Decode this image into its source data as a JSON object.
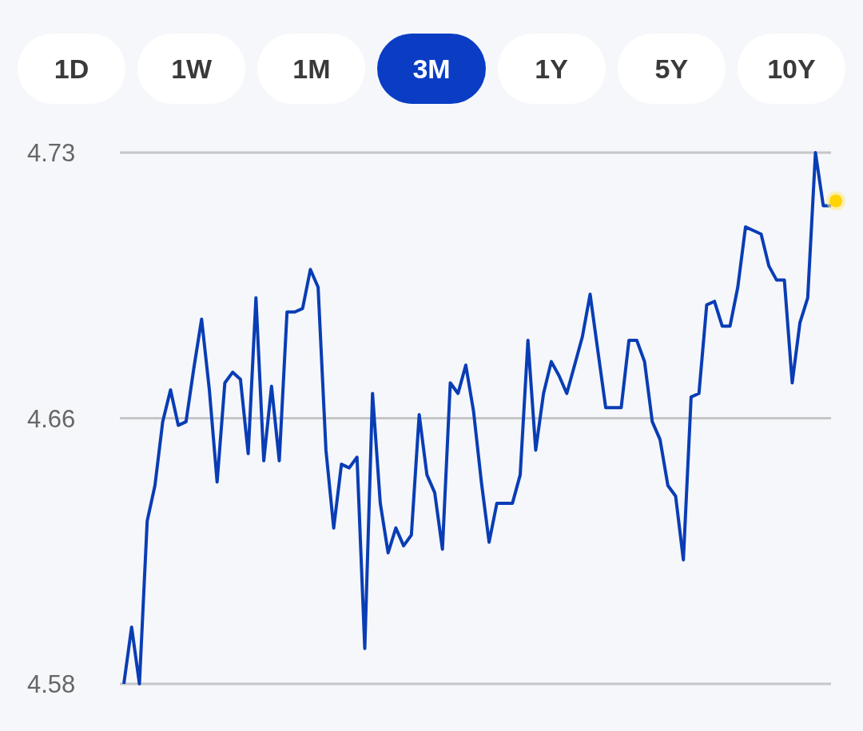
{
  "range_tabs": [
    {
      "label": "1D",
      "selected": false
    },
    {
      "label": "1W",
      "selected": false
    },
    {
      "label": "1M",
      "selected": false
    },
    {
      "label": "3M",
      "selected": true
    },
    {
      "label": "1Y",
      "selected": false
    },
    {
      "label": "5Y",
      "selected": false
    },
    {
      "label": "10Y",
      "selected": false
    }
  ],
  "chart": {
    "chart_data": {
      "type": "line",
      "ylim": [
        4.58,
        4.73
      ],
      "yticks": [
        {
          "value": 4.73,
          "label": "4.73"
        },
        {
          "value": 4.655,
          "label": "4.66"
        },
        {
          "value": 4.58,
          "label": "4.58"
        }
      ],
      "series": [
        {
          "color": "#0a3db5",
          "values": [
            4.58,
            4.596,
            4.58,
            4.626,
            4.636,
            4.654,
            4.663,
            4.653,
            4.654,
            4.669,
            4.683,
            4.663,
            4.637,
            4.665,
            4.668,
            4.666,
            4.645,
            4.689,
            4.643,
            4.664,
            4.643,
            4.685,
            4.685,
            4.686,
            4.697,
            4.692,
            4.646,
            4.624,
            4.642,
            4.641,
            4.644,
            4.59,
            4.662,
            4.631,
            4.617,
            4.624,
            4.619,
            4.622,
            4.656,
            4.639,
            4.634,
            4.618,
            4.665,
            4.662,
            4.67,
            4.657,
            4.637,
            4.62,
            4.631,
            4.631,
            4.631,
            4.639,
            4.677,
            4.646,
            4.662,
            4.671,
            4.667,
            4.662,
            4.67,
            4.678,
            4.69,
            4.674,
            4.658,
            4.658,
            4.658,
            4.677,
            4.677,
            4.671,
            4.654,
            4.649,
            4.636,
            4.633,
            4.615,
            4.661,
            4.662,
            4.687,
            4.688,
            4.681,
            4.681,
            4.692,
            4.709,
            4.708,
            4.707,
            4.698,
            4.694,
            4.694,
            4.665,
            4.682,
            4.689,
            4.73,
            4.715,
            4.715
          ]
        }
      ]
    }
  }
}
